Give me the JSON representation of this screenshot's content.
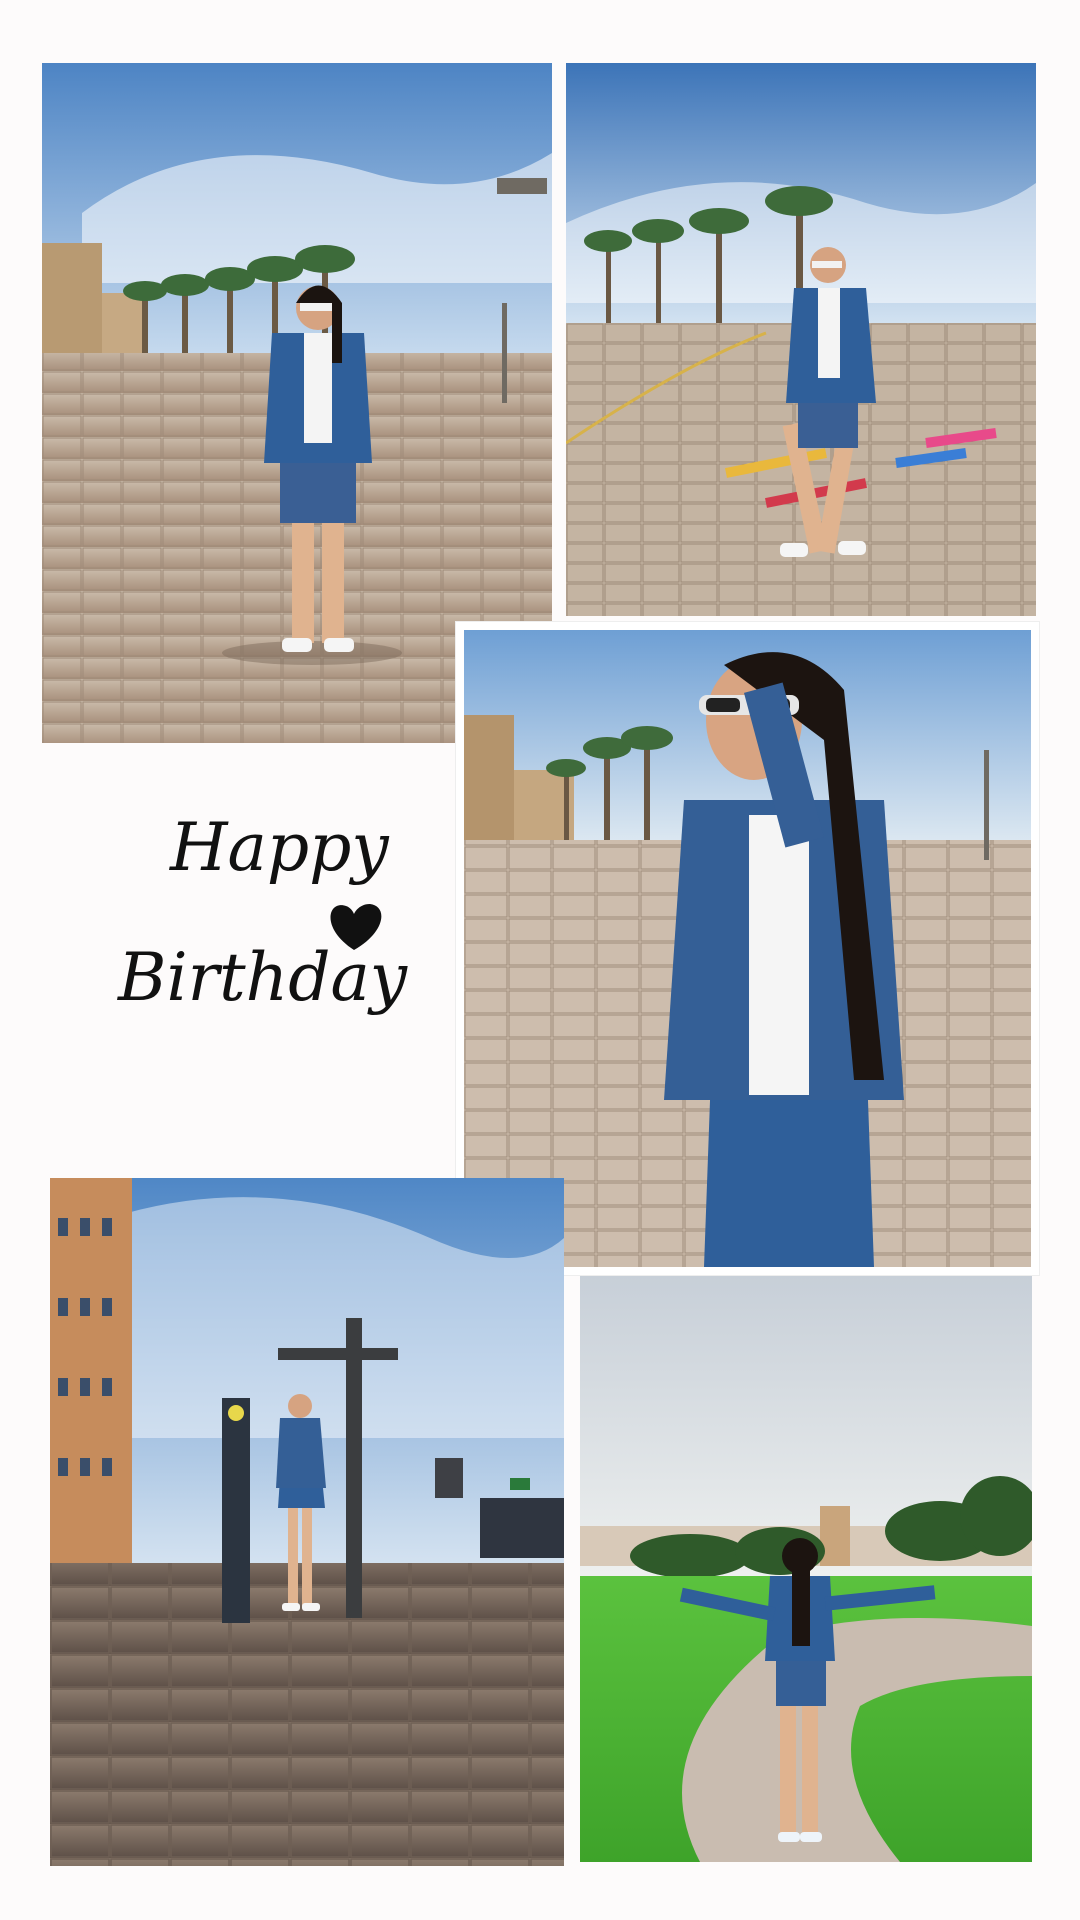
{
  "collage": {
    "background_color": "#fdfbfb",
    "caption": {
      "line1": "Happy",
      "line2": "Birthday",
      "icon": "heart-icon"
    },
    "photos": [
      {
        "id": "photo-1",
        "scene": "plaza",
        "accent": "#2f5f9a"
      },
      {
        "id": "photo-2",
        "scene": "plaza-hopscotch",
        "accent": "#2f5f9a"
      },
      {
        "id": "photo-3",
        "scene": "closeup-plaza",
        "accent": "#2f5f9a"
      },
      {
        "id": "photo-4",
        "scene": "waterfront-signpost",
        "accent": "#2f5f9a"
      },
      {
        "id": "photo-5",
        "scene": "garden-path",
        "accent": "#2f5f9a"
      }
    ]
  }
}
